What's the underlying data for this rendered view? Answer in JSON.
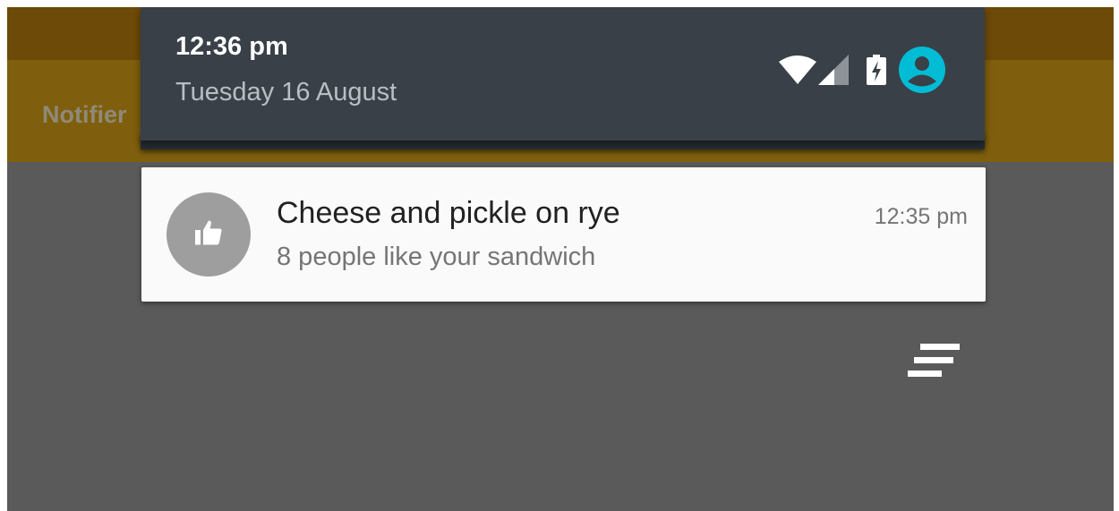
{
  "app": {
    "title": "Notifier"
  },
  "shade": {
    "time": "12:36 pm",
    "date": "Tuesday 16 August",
    "icons": [
      "wifi-icon",
      "signal-icon",
      "battery-charging-icon",
      "user-account-icon"
    ]
  },
  "notification": {
    "title": "Cheese and pickle on rye",
    "text": "8 people like your sandwich",
    "time": "12:35 pm",
    "icon": "thumbs-up-icon"
  },
  "actions": {
    "clear_all_icon": "clear-all-icon"
  },
  "colors": {
    "shade_background": "#394047",
    "card_background": "#fafafa",
    "avatar_background": "#9e9e9e",
    "accent": "#00bcd4",
    "app_toolbar": "#7f5f0e",
    "scrim": "#5a5a5a"
  }
}
